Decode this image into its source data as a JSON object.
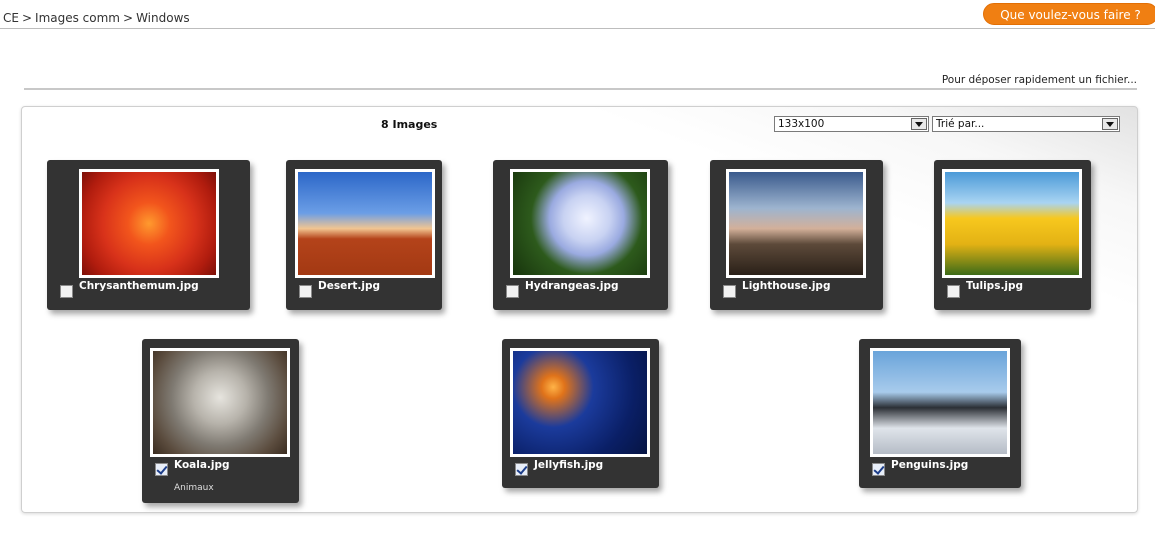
{
  "breadcrumb": {
    "items": [
      "CE",
      "Images comm",
      "Windows"
    ],
    "separator": ">"
  },
  "header": {
    "action_button_label": "Que voulez-vous faire ?"
  },
  "upload_link": "Pour déposer rapidement un fichier...",
  "gallery": {
    "count_label": "8 Images",
    "size_select": {
      "value": "133x100"
    },
    "sort_select": {
      "value": "Trié par..."
    },
    "tiles": [
      {
        "file": "Chrysanthemum.jpg",
        "checked": false
      },
      {
        "file": "Desert.jpg",
        "checked": false
      },
      {
        "file": "Hydrangeas.jpg",
        "checked": false
      },
      {
        "file": "Lighthouse.jpg",
        "checked": false
      },
      {
        "file": "Tulips.jpg",
        "checked": false
      },
      {
        "file": "Koala.jpg",
        "checked": true,
        "tag": "Animaux"
      },
      {
        "file": "Jellyfish.jpg",
        "checked": true
      },
      {
        "file": "Penguins.jpg",
        "checked": true
      }
    ]
  },
  "colors": {
    "accent": "#f07f12",
    "tile_bg": "#333333"
  }
}
